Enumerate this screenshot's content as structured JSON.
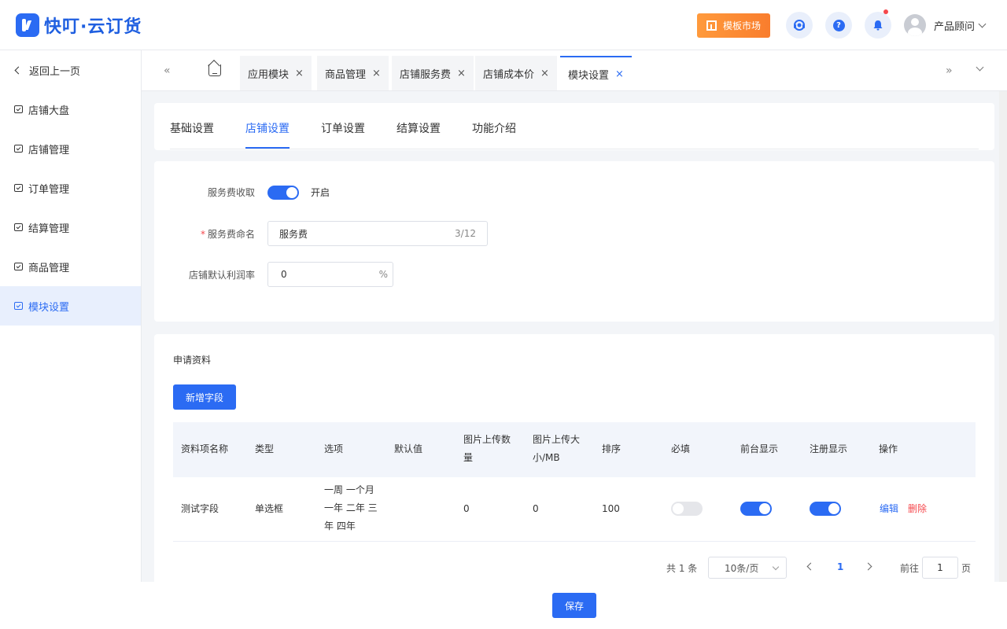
{
  "header": {
    "logo_text": "快叮·云订货",
    "market_label": "模板市场",
    "help_glyph": "?",
    "user_name": "产品顾问"
  },
  "sidebar": {
    "back_label": "返回上一页",
    "items": [
      {
        "label": "店铺大盘"
      },
      {
        "label": "店铺管理"
      },
      {
        "label": "订单管理"
      },
      {
        "label": "结算管理"
      },
      {
        "label": "商品管理"
      },
      {
        "label": "模块设置",
        "active": true
      }
    ]
  },
  "tabs": {
    "items": [
      {
        "label": "应用模块",
        "close": "×"
      },
      {
        "label": "商品管理",
        "close": "×"
      },
      {
        "label": "店铺服务费",
        "close": "×"
      },
      {
        "label": "店铺成本价",
        "close": "×"
      },
      {
        "label": "模块设置",
        "close": "×",
        "active": true
      }
    ],
    "left_arrows": "«",
    "right_arrows": "»"
  },
  "subtabs": [
    "基础设置",
    "店铺设置",
    "订单设置",
    "结算设置",
    "功能介绍"
  ],
  "form": {
    "service_fee_label": "服务费收取",
    "service_fee_state": "开启",
    "fee_name_label": "服务费命名",
    "fee_name_value": "服务费",
    "fee_name_count": "3/12",
    "margin_label": "店铺默认利润率",
    "margin_value": "0",
    "margin_suffix": "%"
  },
  "table": {
    "section_title": "申请资料",
    "add_button": "新增字段",
    "columns": [
      "资料项名称",
      "类型",
      "选项",
      "默认值",
      "图片上传数量",
      "图片上传大小/MB",
      "排序",
      "必填",
      "前台显示",
      "注册显示",
      "操作"
    ],
    "rows": [
      {
        "name": "测试字段",
        "type": "单选框",
        "options": "一周 一个月 一年 二年 三年 四年",
        "default": "",
        "img_count": "0",
        "img_size": "0",
        "sort": "100",
        "required": false,
        "front_display": true,
        "register_display": true,
        "edit": "编辑",
        "delete": "删除"
      }
    ]
  },
  "pagination": {
    "total": "共 1 条",
    "page_size": "10条/页",
    "current_page": "1",
    "goto_label": "前往",
    "goto_value": "1",
    "page_suffix": "页"
  },
  "footer": {
    "save_label": "保存"
  },
  "colors": {
    "primary": "#2b6bf3",
    "market_orange": "#f97d2d",
    "danger": "#f5484d"
  }
}
